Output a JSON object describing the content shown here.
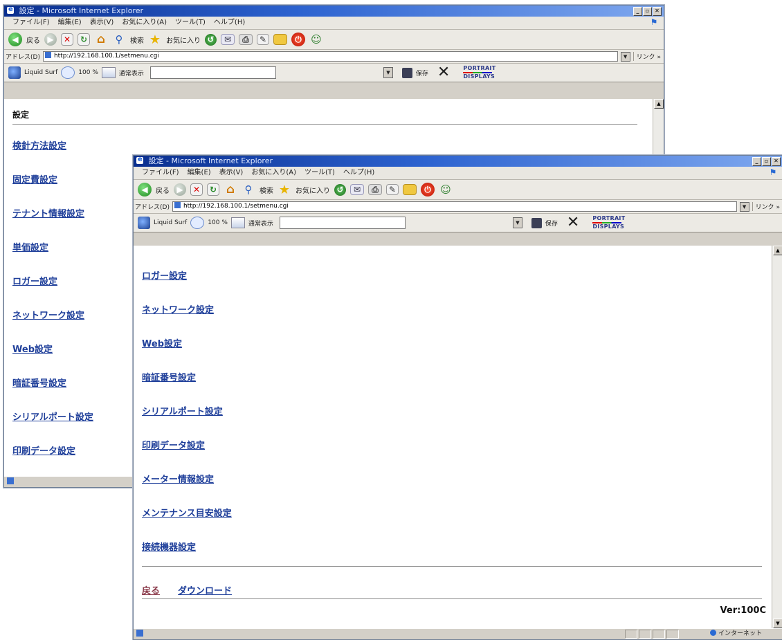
{
  "window_title": "設定 - Microsoft Internet Explorer",
  "window_buttons": [
    "_",
    "▫",
    "✕"
  ],
  "menubar": [
    "ファイル(F)",
    "編集(E)",
    "表示(V)",
    "お気に入り(A)",
    "ツール(T)",
    "ヘルプ(H)"
  ],
  "toolbar": {
    "back_label": "戻る",
    "search_label": "検索",
    "favorites_label": "お気に入り"
  },
  "address": {
    "label": "アドレス(D)",
    "url": "http://192.168.100.1/setmenu.cgi",
    "links_label": "リンク »"
  },
  "liquid_surf": {
    "brand": "Liquid Surf",
    "zoom": "100 %",
    "view_mode": "通常表示",
    "save_label": "保存",
    "logo_top": "PORTRAIT",
    "logo_bottom": "DISPLAYS"
  },
  "back_window": {
    "heading": "設定",
    "links": [
      "検針方法設定",
      "固定費設定",
      "テナント情報設定",
      "単価設定",
      "ロガー設定",
      "ネットワーク設定",
      "Web設定",
      "暗証番号設定",
      "シリアルポート設定",
      "印刷データ設定"
    ]
  },
  "front_window": {
    "links": [
      "ロガー設定",
      "ネットワーク設定",
      "Web設定",
      "暗証番号設定",
      "シリアルポート設定",
      "印刷データ設定",
      "メーター情報設定",
      "メンテナンス目安設定",
      "接続機器設定"
    ],
    "footer_back": "戻る",
    "footer_download": "ダウンロード",
    "version": "Ver:100C",
    "status_zone": "インターネット"
  },
  "colors": {
    "link": "#1f3f9a",
    "visited_link": "#8a3a4a",
    "title_bar": "#0a2f8f"
  }
}
